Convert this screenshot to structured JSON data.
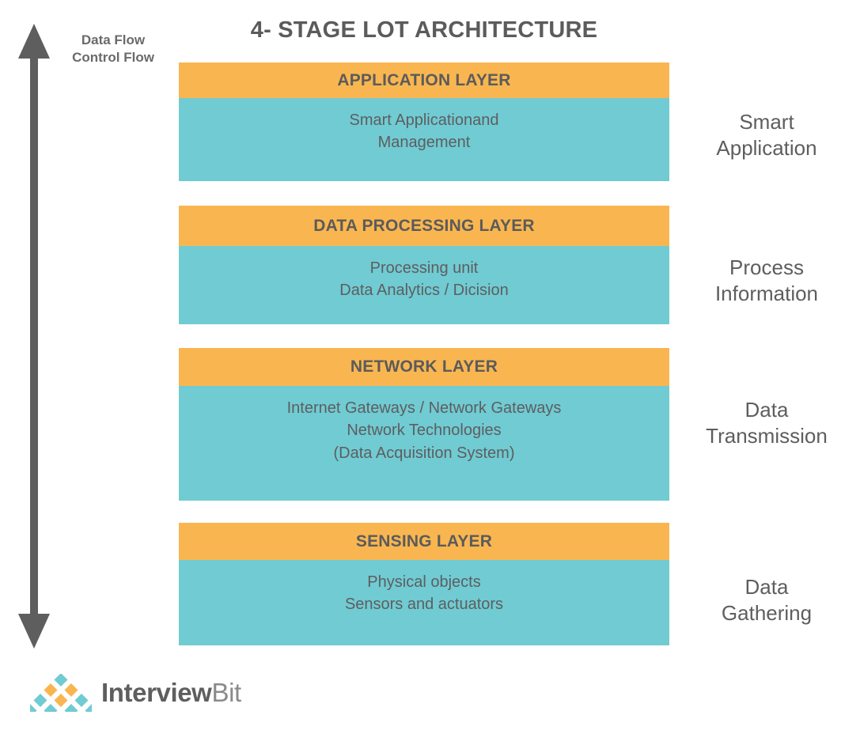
{
  "title": "4- STAGE LOT ARCHITECTURE",
  "flow_arrow": {
    "icon": "double-headed-vertical-arrow",
    "label_line_1": "Data Flow",
    "label_line_2": "Control Flow",
    "color": "#5e5e5e"
  },
  "colors": {
    "header_band": "#f9b650",
    "body_band": "#70cbd3",
    "text": "#5e5e5e",
    "title_text": "#5b5b5b",
    "background": "#ffffff"
  },
  "layers": [
    {
      "header": "APPLICATION LAYER",
      "body_lines": [
        "Smart Applicationand",
        "Management"
      ],
      "stage_label_lines": [
        "Smart",
        "Application"
      ]
    },
    {
      "header": "DATA PROCESSING LAYER",
      "body_lines": [
        "Processing unit",
        "Data Analytics / Dicision"
      ],
      "stage_label_lines": [
        "Process",
        "Information"
      ]
    },
    {
      "header": "NETWORK LAYER",
      "body_lines": [
        "Internet Gateways / Network Gateways",
        "Network Technologies",
        "(Data Acquisition System)"
      ],
      "stage_label_lines": [
        "Data",
        "Transmission"
      ]
    },
    {
      "header": "SENSING LAYER",
      "body_lines": [
        "Physical objects",
        "Sensors and actuators"
      ],
      "stage_label_lines": [
        "Data",
        "Gathering"
      ]
    }
  ],
  "footer": {
    "logo_mark": "interviewbit-diamond-pyramid-logo",
    "brand_bold": "Interview",
    "brand_light": "Bit",
    "logo_teal": "#70cbd3",
    "logo_orange": "#f9b650"
  }
}
